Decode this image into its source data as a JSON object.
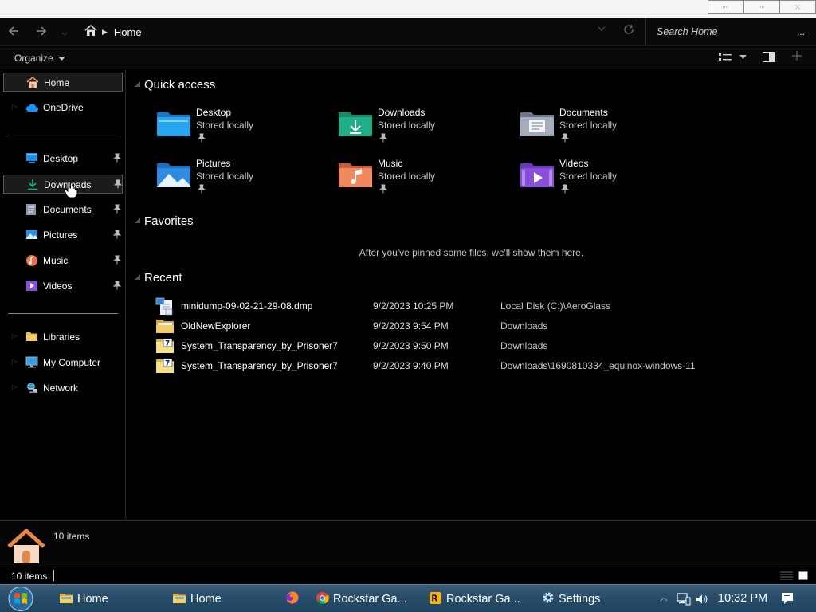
{
  "window": {
    "title": "Home"
  },
  "address_bar": {
    "current": "Home",
    "search_placeholder": "Search Home",
    "more": "..."
  },
  "toolbar": {
    "organize": "Organize"
  },
  "nav_pane": {
    "items": [
      {
        "label": "Home",
        "selected": true
      },
      {
        "label": "OneDrive"
      },
      {
        "label": "Desktop",
        "pinned": true
      },
      {
        "label": "Downloads",
        "pinned": true,
        "hover": true
      },
      {
        "label": "Documents",
        "pinned": true
      },
      {
        "label": "Pictures",
        "pinned": true
      },
      {
        "label": "Music",
        "pinned": true
      },
      {
        "label": "Videos",
        "pinned": true
      },
      {
        "label": "Libraries"
      },
      {
        "label": "My Computer"
      },
      {
        "label": "Network"
      }
    ]
  },
  "quick_access": {
    "header": "Quick access",
    "tiles": [
      {
        "name": "Desktop",
        "sub": "Stored locally",
        "icon": "desktop-folder-icon"
      },
      {
        "name": "Downloads",
        "sub": "Stored locally",
        "icon": "downloads-folder-icon"
      },
      {
        "name": "Documents",
        "sub": "Stored locally",
        "icon": "documents-folder-icon"
      },
      {
        "name": "Pictures",
        "sub": "Stored locally",
        "icon": "pictures-folder-icon"
      },
      {
        "name": "Music",
        "sub": "Stored locally",
        "icon": "music-folder-icon"
      },
      {
        "name": "Videos",
        "sub": "Stored locally",
        "icon": "videos-folder-icon"
      }
    ]
  },
  "favorites": {
    "header": "Favorites",
    "empty_text": "After you've pinned some files, we'll show them here."
  },
  "recent": {
    "header": "Recent",
    "rows": [
      {
        "name": "minidump-09-02-21-29-08.dmp",
        "date": "9/2/2023 10:25 PM",
        "location": "Local Disk (C:)\\AeroGlass",
        "icon": "dump-file-icon"
      },
      {
        "name": "OldNewExplorer",
        "date": "9/2/2023 9:54 PM",
        "location": "Downloads",
        "icon": "folder-icon"
      },
      {
        "name": "System_Transparency_by_Prisoner7",
        "date": "9/2/2023 9:50 PM",
        "location": "Downloads",
        "icon": "zip-archive-icon"
      },
      {
        "name": "System_Transparency_by_Prisoner7",
        "date": "9/2/2023 9:40 PM",
        "location": "Downloads\\1690810334_equinox-windows-11",
        "icon": "zip-archive-icon"
      }
    ]
  },
  "details_pane": {
    "count": "10 items"
  },
  "status_bar": {
    "text": "10 items"
  },
  "taskbar": {
    "tasks": [
      {
        "label": "Home",
        "icon": "folder-icon"
      },
      {
        "label": "Home",
        "icon": "folder-icon"
      },
      {
        "label": "",
        "icon": "firefox-icon"
      },
      {
        "label": "Rockstar Ga...",
        "icon": "chrome-icon"
      },
      {
        "label": "Rockstar Ga...",
        "icon": "rockstar-icon"
      },
      {
        "label": "Settings",
        "icon": "gear-icon"
      }
    ],
    "clock": "10:32 PM"
  },
  "colors": {
    "background": "#000000",
    "taskbar": "#2a4f6c",
    "selection_border": "#555555",
    "downloads_green": "#1fae86",
    "pictures_blue": "#2d8be0",
    "music_orange": "#e8734a",
    "videos_purple": "#8a4fd8"
  }
}
